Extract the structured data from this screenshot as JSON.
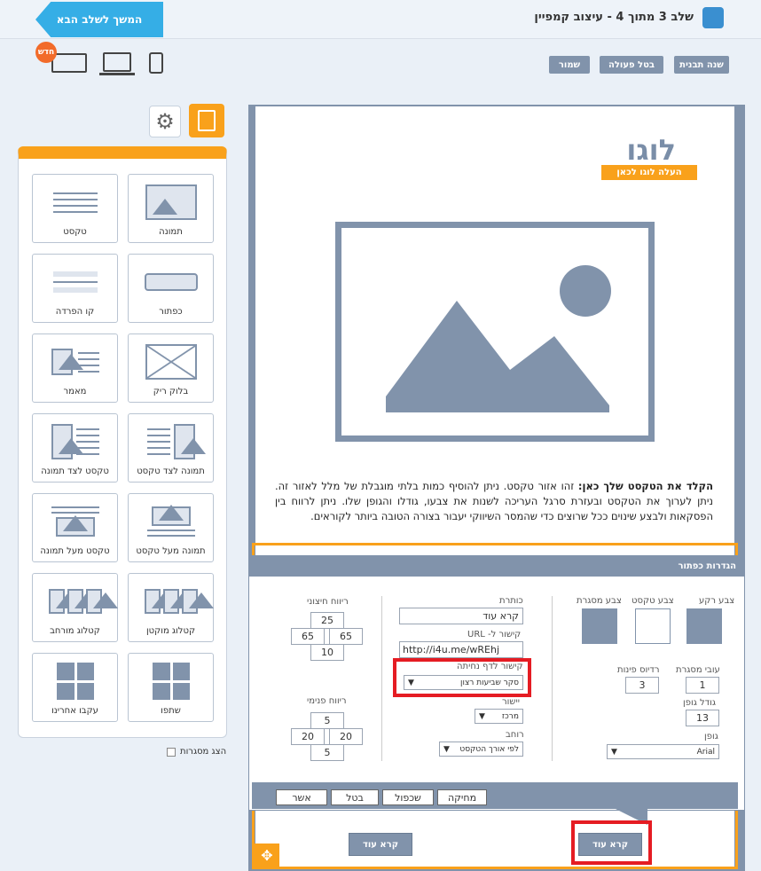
{
  "header": {
    "step_title": "שלב 3 מתוך 4 - עיצוב קמפיין",
    "next_button": "המשך לשלב הבא"
  },
  "toolbar": {
    "change_template": "שנה תבנית",
    "undo": "בטל פעולה",
    "save": "שמור",
    "new_badge": "חדש"
  },
  "panel": {
    "tiles": [
      {
        "label": "תמונה",
        "icon": "image-icon"
      },
      {
        "label": "טקסט",
        "icon": "text-icon"
      },
      {
        "label": "כפתור",
        "icon": "button-icon"
      },
      {
        "label": "קו הפרדה",
        "icon": "divider-icon"
      },
      {
        "label": "בלוק ריק",
        "icon": "empty-block-icon"
      },
      {
        "label": "מאמר",
        "icon": "article-icon"
      },
      {
        "label": "תמונה לצד טקסט",
        "icon": "image-beside-text-icon"
      },
      {
        "label": "טקסט לצד תמונה",
        "icon": "text-beside-image-icon"
      },
      {
        "label": "תמונה מעל טקסט",
        "icon": "image-above-text-icon"
      },
      {
        "label": "טקסט מעל תמונה",
        "icon": "text-above-image-icon"
      },
      {
        "label": "קטלוג מוקטן",
        "icon": "small-catalog-icon"
      },
      {
        "label": "קטלוג מורחב",
        "icon": "wide-catalog-icon"
      },
      {
        "label": "שתפו",
        "icon": "share-icon"
      },
      {
        "label": "עקבו אחרינו",
        "icon": "follow-us-icon"
      }
    ],
    "show_borders": "הצג מסגרות"
  },
  "email": {
    "logo": "לוגו",
    "upload_logo": "העלה לוגו לכאן",
    "body_bold": "הקלד את הטקסט שלך כאן:",
    "body_text": " זהו אזור טקסט. ניתן להוסיף כמות בלתי מוגבלת של מלל לאזור זה. ניתן לערוך את הטקסט ובעזרת סרגל העריכה לשנות את צבעו, גודלו והגופן שלו. ניתן לרווח בין הפסקאות ולבצע שינוים ככל שרוצים כדי שהמסר השיווקי יעבור בצורה הטובה ביותר לקוראים.",
    "cta_main": "קרא עוד",
    "cta_secondary": "קרא עוד"
  },
  "dialog": {
    "title": "הגדרות כפתור",
    "bg_color": "צבע רקע",
    "text_color": "צבע טקסט",
    "border_color": "צבע מסגרת",
    "colors": {
      "bg": "#8193ab",
      "text": "#ffffff",
      "border": "#8193ab"
    },
    "border_width_label": "עובי מסגרת",
    "border_width": "1",
    "radius_label": "רדיוס פינות",
    "radius": "3",
    "font_size_label": "גודל גופן",
    "font_size": "13",
    "font_label": "גופן",
    "font": "Arial",
    "caption_label": "כותרת",
    "caption": "קרא עוד",
    "url_label": "קישור ל- URL",
    "url": "http://i4u.me/wREhj",
    "landing_label": "קישור לדף נחיתה",
    "landing": "סקר שביעות רצון",
    "align_label": "יישור",
    "align": "מרכז",
    "width_label": "רוחב",
    "width": "לפי אורך הטקסט",
    "outer_label": "ריווח חיצוני",
    "outer": {
      "top": "25",
      "left": "65",
      "right": "65",
      "bottom": "10"
    },
    "inner_label": "ריווח פנימי",
    "inner": {
      "top": "5",
      "left": "20",
      "right": "20",
      "bottom": "5"
    },
    "buttons": {
      "delete": "מחיקה",
      "duplicate": "שכפול",
      "cancel": "בטל",
      "confirm": "אשר"
    }
  }
}
